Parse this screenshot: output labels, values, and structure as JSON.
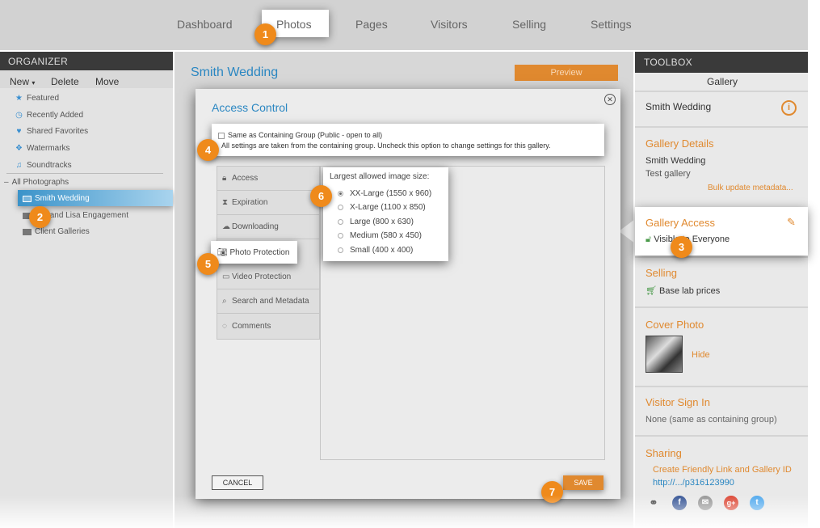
{
  "topnav": {
    "items": [
      "Dashboard",
      "Photos",
      "Pages",
      "Visitors",
      "Selling",
      "Settings"
    ],
    "active": "Photos"
  },
  "organizer": {
    "header": "ORGANIZER",
    "tools": {
      "new": "New",
      "delete": "Delete",
      "move": "Move"
    },
    "items": [
      "Featured",
      "Recently Added",
      "Shared Favorites",
      "Watermarks",
      "Soundtracks"
    ],
    "all_photos": "All Photographs",
    "tree": [
      "Smith Wedding",
      "Jeff and Lisa Engagement",
      "Client Galleries"
    ]
  },
  "main": {
    "title": "Smith Wedding",
    "preview_label": "Preview"
  },
  "dialog": {
    "title": "Access Control",
    "same_label": "Same as Containing Group (Public - open to all)",
    "same_note": "All settings are taken from the containing group. Uncheck this option to change settings for this gallery.",
    "tabs": [
      "Access",
      "Expiration",
      "Downloading",
      "Photo Protection",
      "Video Protection",
      "Search and Metadata",
      "Comments"
    ],
    "size_label": "Largest allowed image size:",
    "sizes": [
      "XX-Large (1550 x 960)",
      "X-Large (1100 x 850)",
      "Large (800 x 630)",
      "Medium (580 x 450)",
      "Small (400 x 400)"
    ],
    "selected_size": "XX-Large (1550 x 960)",
    "cancel_label": "CANCEL",
    "save_label": "SAVE"
  },
  "toolbox": {
    "header": "TOOLBOX",
    "subtitle": "Gallery",
    "gallery_name": "Smith Wedding",
    "details_title": "Gallery Details",
    "details_name": "Smith Wedding",
    "details_desc": "Test gallery",
    "bulk_link": "Bulk update metadata...",
    "access_title": "Gallery Access",
    "access_value": "Visible to Everyone",
    "selling_title": "Selling",
    "selling_value": "Base lab prices",
    "cover_title": "Cover Photo",
    "cover_hide": "Hide",
    "signin_title": "Visitor Sign In",
    "signin_value": "None (same as containing group)",
    "sharing_title": "Sharing",
    "sharing_link": "Create Friendly Link and Gallery ID",
    "sharing_url": "http://.../p316123990"
  },
  "callouts": [
    "1",
    "2",
    "3",
    "4",
    "5",
    "6",
    "7"
  ],
  "colors": {
    "accent": "#e0892f",
    "link_blue": "#2b87c2",
    "callout": "#ef8a1b"
  }
}
